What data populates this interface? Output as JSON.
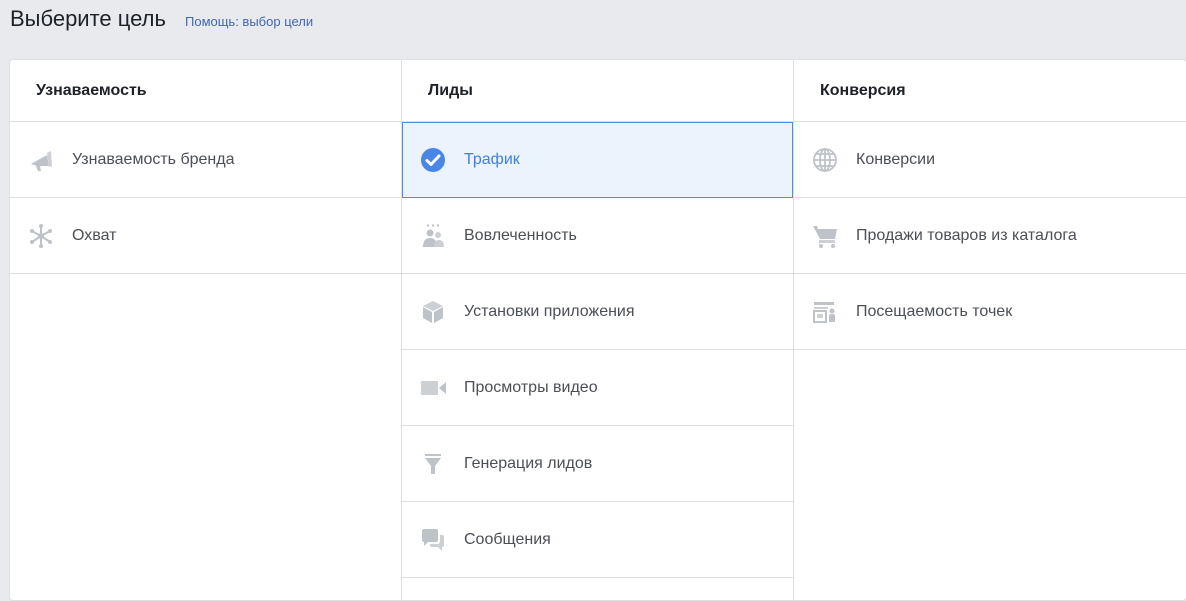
{
  "header": {
    "title": "Выберите цель",
    "help_link": "Помощь: выбор цели"
  },
  "columns": [
    {
      "title": "Узнаваемость",
      "items": [
        {
          "label": "Узнаваемость бренда",
          "icon": "megaphone-icon"
        },
        {
          "label": "Охват",
          "icon": "reach-icon"
        }
      ]
    },
    {
      "title": "Лиды",
      "items": [
        {
          "label": "Трафик",
          "icon": "checkmark-circle-icon",
          "selected": true
        },
        {
          "label": "Вовлеченность",
          "icon": "people-icon"
        },
        {
          "label": "Установки приложения",
          "icon": "box-icon"
        },
        {
          "label": "Просмотры видео",
          "icon": "video-camera-icon"
        },
        {
          "label": "Генерация лидов",
          "icon": "funnel-icon"
        },
        {
          "label": "Сообщения",
          "icon": "chat-bubbles-icon"
        }
      ]
    },
    {
      "title": "Конверсия",
      "items": [
        {
          "label": "Конверсии",
          "icon": "globe-icon"
        },
        {
          "label": "Продажи товаров из каталога",
          "icon": "shopping-cart-icon"
        },
        {
          "label": "Посещаемость точек",
          "icon": "store-icon"
        }
      ]
    }
  ],
  "colors": {
    "background": "#e9eaed",
    "selected_bg": "#ebf3fd",
    "selected_accent": "#4a90e2",
    "icon_gray": "#bec3c9",
    "link": "#4267b2"
  }
}
